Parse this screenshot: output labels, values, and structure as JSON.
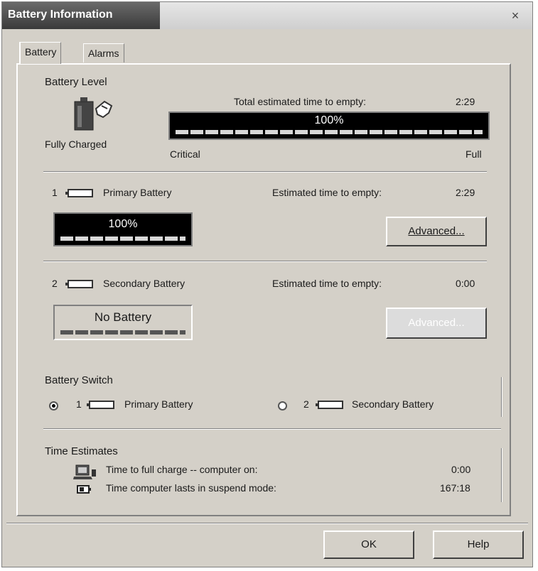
{
  "window": {
    "title": "Battery Information",
    "close_glyph": "×"
  },
  "tabs": [
    {
      "label": "Battery",
      "active": true
    },
    {
      "label": "Alarms",
      "active": false
    }
  ],
  "battery_level": {
    "group_label": "Battery Level",
    "status": "Fully Charged",
    "total_time_label": "Total estimated time to empty:",
    "total_time_value": "2:29",
    "percent": "100%",
    "critical_label": "Critical",
    "full_label": "Full"
  },
  "primary": {
    "index": "1",
    "name": "Primary Battery",
    "time_label": "Estimated time to empty:",
    "time_value": "2:29",
    "percent": "100%",
    "advanced_label": "Advanced..."
  },
  "secondary": {
    "index": "2",
    "name": "Secondary Battery",
    "time_label": "Estimated time to empty:",
    "time_value": "0:00",
    "status": "No Battery",
    "advanced_label": "Advanced..."
  },
  "battery_switch": {
    "group_label": "Battery Switch",
    "options": [
      {
        "index": "1",
        "label": "Primary Battery",
        "selected": true
      },
      {
        "index": "2",
        "label": "Secondary Battery",
        "selected": false
      }
    ]
  },
  "time_estimates": {
    "group_label": "Time Estimates",
    "rows": [
      {
        "label": "Time to full charge -- computer on:",
        "value": "0:00",
        "icon": "laptop-icon"
      },
      {
        "label": "Time computer lasts in suspend mode:",
        "value": "167:18",
        "icon": "battery-suspend-icon"
      }
    ]
  },
  "footer": {
    "ok_label": "OK",
    "help_label": "Help"
  }
}
